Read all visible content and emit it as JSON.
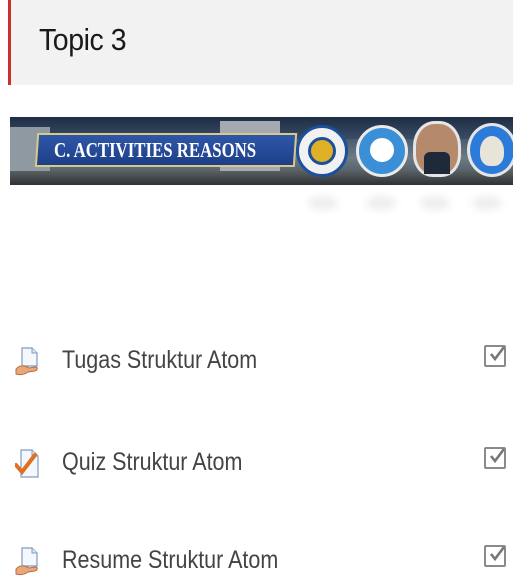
{
  "topic": {
    "title": "Topic 3"
  },
  "banner": {
    "label": "C. ACTIVITIES REASONS"
  },
  "activities": [
    {
      "label": "Tugas Struktur Atom",
      "icon": "assignment-icon",
      "completed": true
    },
    {
      "label": "Quiz Struktur Atom",
      "icon": "quiz-icon",
      "completed": true
    },
    {
      "label": "Resume Struktur Atom",
      "icon": "assignment-icon",
      "completed": true
    }
  ],
  "colors": {
    "accent": "#c9302c",
    "text": "#444444",
    "header_bg": "#f2f2f2"
  }
}
